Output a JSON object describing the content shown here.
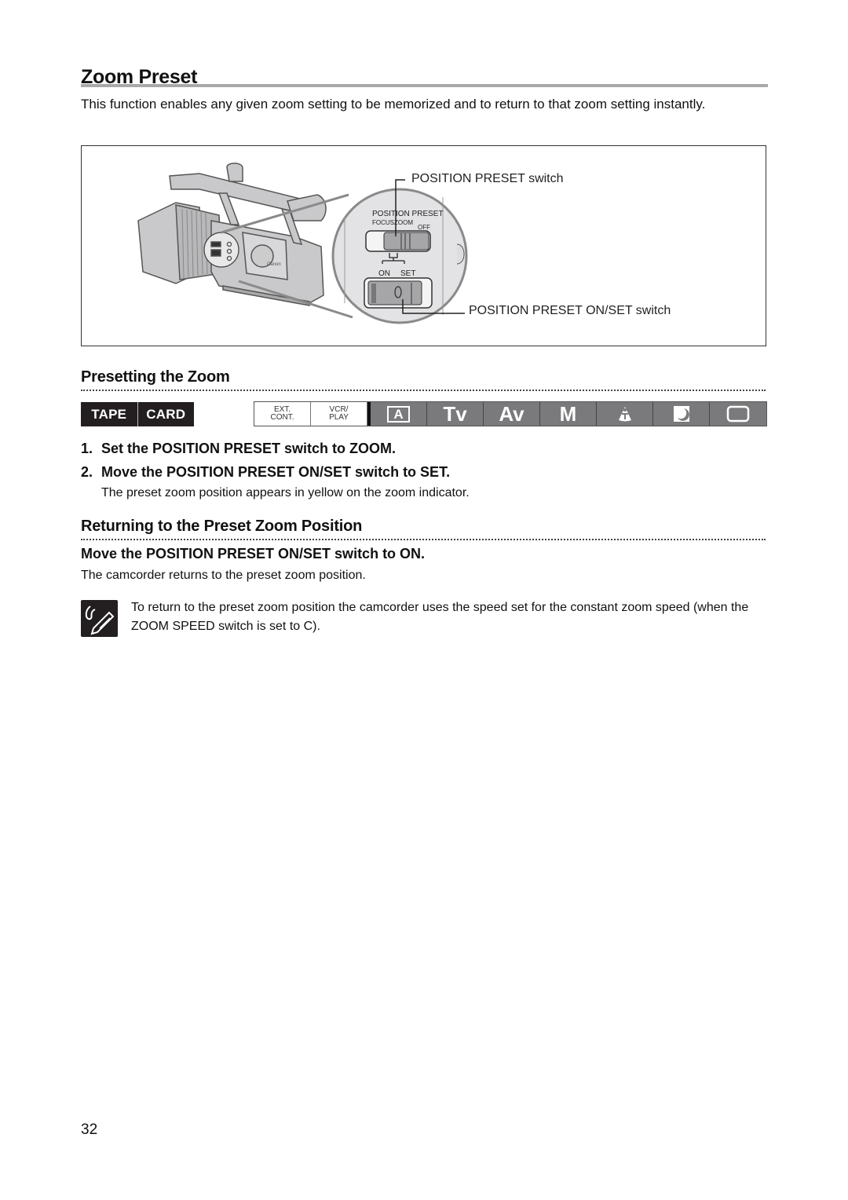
{
  "page": {
    "title": "Zoom Preset",
    "intro": "This function enables any given zoom setting to be memorized and to return to that zoom setting instantly.",
    "page_number": "32"
  },
  "figure": {
    "callouts": {
      "position_preset_switch": "POSITION PRESET switch",
      "on_set_switch": "POSITION PRESET ON/SET switch"
    },
    "switch_labels": {
      "position_preset": "POSITION PRESET",
      "focus": "FOCUS",
      "zoom": "ZOOM",
      "off": "OFF",
      "on": "ON",
      "set": "SET"
    },
    "brand_text": "Canon"
  },
  "presetting": {
    "heading": "Presetting the Zoom",
    "media": [
      "TAPE",
      "CARD"
    ],
    "modes": {
      "light": [
        {
          "line1": "EXT.",
          "line2": "CONT."
        },
        {
          "line1": "VCR/",
          "line2": "PLAY"
        }
      ],
      "dark": [
        {
          "label": "A",
          "icon": "auto-mode-icon"
        },
        {
          "label": "Tv",
          "icon": "tv-mode-icon"
        },
        {
          "label": "Av",
          "icon": "av-mode-icon"
        },
        {
          "label": "M",
          "icon": "manual-mode-icon"
        },
        {
          "label": "",
          "icon": "spotlight-mode-icon"
        },
        {
          "label": "",
          "icon": "night-mode-icon"
        },
        {
          "label": "",
          "icon": "easy-recording-icon"
        }
      ]
    },
    "steps": [
      {
        "num": "1.",
        "text": "Set the POSITION PRESET switch to ZOOM."
      },
      {
        "num": "2.",
        "text": "Move the POSITION PRESET ON/SET switch to SET."
      }
    ],
    "step2_note": "The preset zoom position appears in yellow on the zoom indicator."
  },
  "returning": {
    "heading": "Returning to the Preset Zoom Position",
    "instruction": "Move the POSITION PRESET ON/SET switch to ON.",
    "result": "The camcorder returns to the preset zoom position.",
    "note": "To return to the preset zoom position the camcorder uses the speed set for the constant zoom speed (when the ZOOM SPEED switch is set to C)."
  }
}
